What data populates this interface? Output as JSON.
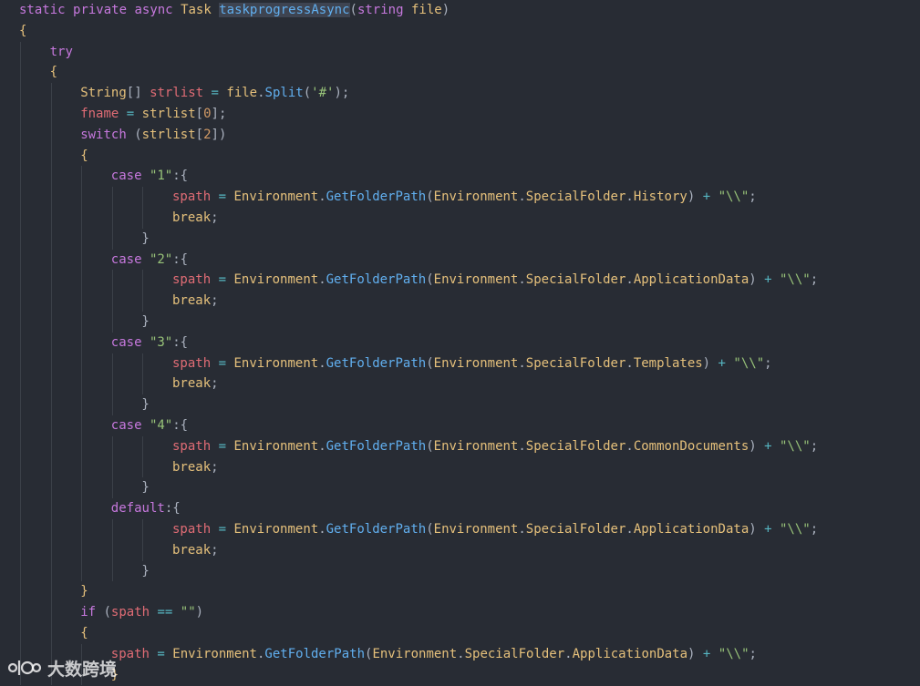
{
  "editor": {
    "background": "#282c34",
    "lines": [
      {
        "indent": 0,
        "tokens": [
          {
            "t": "static",
            "c": "kw"
          },
          {
            "t": " ",
            "c": "plain"
          },
          {
            "t": "private",
            "c": "kw"
          },
          {
            "t": " ",
            "c": "plain"
          },
          {
            "t": "async",
            "c": "kw"
          },
          {
            "t": " ",
            "c": "plain"
          },
          {
            "t": "Task",
            "c": "type"
          },
          {
            "t": " ",
            "c": "plain"
          },
          {
            "t": "taskprogressAsync",
            "c": "fn",
            "sel": true
          },
          {
            "t": "(",
            "c": "punc"
          },
          {
            "t": "string",
            "c": "kw"
          },
          {
            "t": " ",
            "c": "plain"
          },
          {
            "t": "file",
            "c": "name"
          },
          {
            "t": ")",
            "c": "punc"
          }
        ]
      },
      {
        "indent": 0,
        "tokens": [
          {
            "t": "{",
            "c": "brace"
          }
        ]
      },
      {
        "indent": 1,
        "tokens": [
          {
            "t": "try",
            "c": "kw"
          }
        ]
      },
      {
        "indent": 1,
        "tokens": [
          {
            "t": "{",
            "c": "brace"
          }
        ]
      },
      {
        "indent": 2,
        "tokens": [
          {
            "t": "String",
            "c": "type"
          },
          {
            "t": "[]",
            "c": "punc"
          },
          {
            "t": " ",
            "c": "plain"
          },
          {
            "t": "strlist",
            "c": "var"
          },
          {
            "t": " ",
            "c": "plain"
          },
          {
            "t": "=",
            "c": "op"
          },
          {
            "t": " ",
            "c": "plain"
          },
          {
            "t": "file",
            "c": "name"
          },
          {
            "t": ".",
            "c": "punc"
          },
          {
            "t": "Split",
            "c": "fn"
          },
          {
            "t": "(",
            "c": "punc"
          },
          {
            "t": "'#'",
            "c": "str"
          },
          {
            "t": ");",
            "c": "punc"
          }
        ]
      },
      {
        "indent": 2,
        "tokens": [
          {
            "t": "fname",
            "c": "var"
          },
          {
            "t": " ",
            "c": "plain"
          },
          {
            "t": "=",
            "c": "op"
          },
          {
            "t": " ",
            "c": "plain"
          },
          {
            "t": "strlist",
            "c": "name"
          },
          {
            "t": "[",
            "c": "punc"
          },
          {
            "t": "0",
            "c": "num"
          },
          {
            "t": "];",
            "c": "punc"
          }
        ]
      },
      {
        "indent": 2,
        "tokens": [
          {
            "t": "switch",
            "c": "kw"
          },
          {
            "t": " (",
            "c": "punc"
          },
          {
            "t": "strlist",
            "c": "name"
          },
          {
            "t": "[",
            "c": "punc"
          },
          {
            "t": "2",
            "c": "num"
          },
          {
            "t": "])",
            "c": "punc"
          }
        ]
      },
      {
        "indent": 2,
        "tokens": [
          {
            "t": "{",
            "c": "brace"
          }
        ]
      },
      {
        "indent": 3,
        "tokens": [
          {
            "t": "case",
            "c": "kw"
          },
          {
            "t": " ",
            "c": "plain"
          },
          {
            "t": "\"1\"",
            "c": "str"
          },
          {
            "t": ":{",
            "c": "punc"
          }
        ]
      },
      {
        "indent": 5,
        "tokens": [
          {
            "t": "spath",
            "c": "var"
          },
          {
            "t": " ",
            "c": "plain"
          },
          {
            "t": "=",
            "c": "op"
          },
          {
            "t": " ",
            "c": "plain"
          },
          {
            "t": "Environment",
            "c": "name"
          },
          {
            "t": ".",
            "c": "punc"
          },
          {
            "t": "GetFolderPath",
            "c": "fn"
          },
          {
            "t": "(",
            "c": "punc"
          },
          {
            "t": "Environment",
            "c": "name"
          },
          {
            "t": ".",
            "c": "punc"
          },
          {
            "t": "SpecialFolder",
            "c": "name"
          },
          {
            "t": ".",
            "c": "punc"
          },
          {
            "t": "History",
            "c": "name"
          },
          {
            "t": ") ",
            "c": "punc"
          },
          {
            "t": "+",
            "c": "op"
          },
          {
            "t": " ",
            "c": "plain"
          },
          {
            "t": "\"\\\\\"",
            "c": "str"
          },
          {
            "t": ";",
            "c": "punc"
          }
        ]
      },
      {
        "indent": 5,
        "tokens": [
          {
            "t": "break",
            "c": "name"
          },
          {
            "t": ";",
            "c": "punc"
          }
        ]
      },
      {
        "indent": 4,
        "tokens": [
          {
            "t": "}",
            "c": "punc"
          }
        ]
      },
      {
        "indent": 3,
        "tokens": [
          {
            "t": "case",
            "c": "kw"
          },
          {
            "t": " ",
            "c": "plain"
          },
          {
            "t": "\"2\"",
            "c": "str"
          },
          {
            "t": ":{",
            "c": "punc"
          }
        ]
      },
      {
        "indent": 5,
        "tokens": [
          {
            "t": "spath",
            "c": "var"
          },
          {
            "t": " ",
            "c": "plain"
          },
          {
            "t": "=",
            "c": "op"
          },
          {
            "t": " ",
            "c": "plain"
          },
          {
            "t": "Environment",
            "c": "name"
          },
          {
            "t": ".",
            "c": "punc"
          },
          {
            "t": "GetFolderPath",
            "c": "fn"
          },
          {
            "t": "(",
            "c": "punc"
          },
          {
            "t": "Environment",
            "c": "name"
          },
          {
            "t": ".",
            "c": "punc"
          },
          {
            "t": "SpecialFolder",
            "c": "name"
          },
          {
            "t": ".",
            "c": "punc"
          },
          {
            "t": "ApplicationData",
            "c": "name"
          },
          {
            "t": ") ",
            "c": "punc"
          },
          {
            "t": "+",
            "c": "op"
          },
          {
            "t": " ",
            "c": "plain"
          },
          {
            "t": "\"\\\\\"",
            "c": "str"
          },
          {
            "t": ";",
            "c": "punc"
          }
        ]
      },
      {
        "indent": 5,
        "tokens": [
          {
            "t": "break",
            "c": "name"
          },
          {
            "t": ";",
            "c": "punc"
          }
        ]
      },
      {
        "indent": 4,
        "tokens": [
          {
            "t": "}",
            "c": "punc"
          }
        ]
      },
      {
        "indent": 3,
        "tokens": [
          {
            "t": "case",
            "c": "kw"
          },
          {
            "t": " ",
            "c": "plain"
          },
          {
            "t": "\"3\"",
            "c": "str"
          },
          {
            "t": ":{",
            "c": "punc"
          }
        ]
      },
      {
        "indent": 5,
        "tokens": [
          {
            "t": "spath",
            "c": "var"
          },
          {
            "t": " ",
            "c": "plain"
          },
          {
            "t": "=",
            "c": "op"
          },
          {
            "t": " ",
            "c": "plain"
          },
          {
            "t": "Environment",
            "c": "name"
          },
          {
            "t": ".",
            "c": "punc"
          },
          {
            "t": "GetFolderPath",
            "c": "fn"
          },
          {
            "t": "(",
            "c": "punc"
          },
          {
            "t": "Environment",
            "c": "name"
          },
          {
            "t": ".",
            "c": "punc"
          },
          {
            "t": "SpecialFolder",
            "c": "name"
          },
          {
            "t": ".",
            "c": "punc"
          },
          {
            "t": "Templates",
            "c": "name"
          },
          {
            "t": ") ",
            "c": "punc"
          },
          {
            "t": "+",
            "c": "op"
          },
          {
            "t": " ",
            "c": "plain"
          },
          {
            "t": "\"\\\\\"",
            "c": "str"
          },
          {
            "t": ";",
            "c": "punc"
          }
        ]
      },
      {
        "indent": 5,
        "tokens": [
          {
            "t": "break",
            "c": "name"
          },
          {
            "t": ";",
            "c": "punc"
          }
        ]
      },
      {
        "indent": 4,
        "tokens": [
          {
            "t": "}",
            "c": "punc"
          }
        ]
      },
      {
        "indent": 3,
        "tokens": [
          {
            "t": "case",
            "c": "kw"
          },
          {
            "t": " ",
            "c": "plain"
          },
          {
            "t": "\"4\"",
            "c": "str"
          },
          {
            "t": ":{",
            "c": "punc"
          }
        ]
      },
      {
        "indent": 5,
        "tokens": [
          {
            "t": "spath",
            "c": "var"
          },
          {
            "t": " ",
            "c": "plain"
          },
          {
            "t": "=",
            "c": "op"
          },
          {
            "t": " ",
            "c": "plain"
          },
          {
            "t": "Environment",
            "c": "name"
          },
          {
            "t": ".",
            "c": "punc"
          },
          {
            "t": "GetFolderPath",
            "c": "fn"
          },
          {
            "t": "(",
            "c": "punc"
          },
          {
            "t": "Environment",
            "c": "name"
          },
          {
            "t": ".",
            "c": "punc"
          },
          {
            "t": "SpecialFolder",
            "c": "name"
          },
          {
            "t": ".",
            "c": "punc"
          },
          {
            "t": "CommonDocuments",
            "c": "name"
          },
          {
            "t": ") ",
            "c": "punc"
          },
          {
            "t": "+",
            "c": "op"
          },
          {
            "t": " ",
            "c": "plain"
          },
          {
            "t": "\"\\\\\"",
            "c": "str"
          },
          {
            "t": ";",
            "c": "punc"
          }
        ]
      },
      {
        "indent": 5,
        "tokens": [
          {
            "t": "break",
            "c": "name"
          },
          {
            "t": ";",
            "c": "punc"
          }
        ]
      },
      {
        "indent": 4,
        "tokens": [
          {
            "t": "}",
            "c": "punc"
          }
        ]
      },
      {
        "indent": 3,
        "tokens": [
          {
            "t": "default",
            "c": "kw"
          },
          {
            "t": ":{",
            "c": "punc"
          }
        ]
      },
      {
        "indent": 5,
        "tokens": [
          {
            "t": "spath",
            "c": "var"
          },
          {
            "t": " ",
            "c": "plain"
          },
          {
            "t": "=",
            "c": "op"
          },
          {
            "t": " ",
            "c": "plain"
          },
          {
            "t": "Environment",
            "c": "name"
          },
          {
            "t": ".",
            "c": "punc"
          },
          {
            "t": "GetFolderPath",
            "c": "fn"
          },
          {
            "t": "(",
            "c": "punc"
          },
          {
            "t": "Environment",
            "c": "name"
          },
          {
            "t": ".",
            "c": "punc"
          },
          {
            "t": "SpecialFolder",
            "c": "name"
          },
          {
            "t": ".",
            "c": "punc"
          },
          {
            "t": "ApplicationData",
            "c": "name"
          },
          {
            "t": ") ",
            "c": "punc"
          },
          {
            "t": "+",
            "c": "op"
          },
          {
            "t": " ",
            "c": "plain"
          },
          {
            "t": "\"\\\\\"",
            "c": "str"
          },
          {
            "t": ";",
            "c": "punc"
          }
        ]
      },
      {
        "indent": 5,
        "tokens": [
          {
            "t": "break",
            "c": "name"
          },
          {
            "t": ";",
            "c": "punc"
          }
        ]
      },
      {
        "indent": 4,
        "tokens": [
          {
            "t": "}",
            "c": "punc"
          }
        ]
      },
      {
        "indent": 2,
        "tokens": [
          {
            "t": "}",
            "c": "brace"
          }
        ]
      },
      {
        "indent": 2,
        "tokens": [
          {
            "t": "if",
            "c": "kw"
          },
          {
            "t": " (",
            "c": "punc"
          },
          {
            "t": "spath",
            "c": "var"
          },
          {
            "t": " ",
            "c": "plain"
          },
          {
            "t": "==",
            "c": "op"
          },
          {
            "t": " ",
            "c": "plain"
          },
          {
            "t": "\"\"",
            "c": "str"
          },
          {
            "t": ")",
            "c": "punc"
          }
        ]
      },
      {
        "indent": 2,
        "tokens": [
          {
            "t": "{",
            "c": "brace"
          }
        ]
      },
      {
        "indent": 3,
        "tokens": [
          {
            "t": "spath",
            "c": "var"
          },
          {
            "t": " ",
            "c": "plain"
          },
          {
            "t": "=",
            "c": "op"
          },
          {
            "t": " ",
            "c": "plain"
          },
          {
            "t": "Environment",
            "c": "name"
          },
          {
            "t": ".",
            "c": "punc"
          },
          {
            "t": "GetFolderPath",
            "c": "fn"
          },
          {
            "t": "(",
            "c": "punc"
          },
          {
            "t": "Environment",
            "c": "name"
          },
          {
            "t": ".",
            "c": "punc"
          },
          {
            "t": "SpecialFolder",
            "c": "name"
          },
          {
            "t": ".",
            "c": "punc"
          },
          {
            "t": "ApplicationData",
            "c": "name"
          },
          {
            "t": ") ",
            "c": "punc"
          },
          {
            "t": "+",
            "c": "op"
          },
          {
            "t": " ",
            "c": "plain"
          },
          {
            "t": "\"\\\\\"",
            "c": "str"
          },
          {
            "t": ";",
            "c": "punc"
          }
        ]
      },
      {
        "indent": 3,
        "tokens": [
          {
            "t": "}",
            "c": "brace"
          }
        ]
      }
    ]
  },
  "watermark": {
    "text": "大数跨境",
    "icon": "brand-logo-icon"
  }
}
